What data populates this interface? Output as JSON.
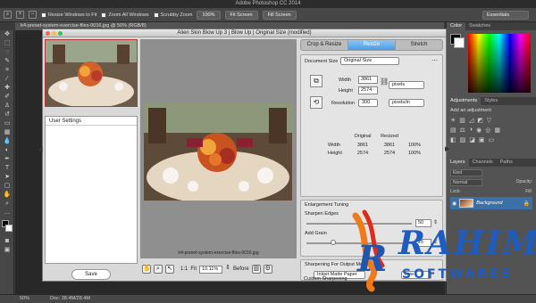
{
  "app": {
    "title": "Adobe Photoshop CC 2014",
    "document_tab": "lr4-preset-system-exercise-files-0016.jpg @ 50% (RGB/8)",
    "status_zoom": "50%",
    "status_doc": "Doc: 28.4M/28.4M"
  },
  "options_bar": {
    "resize_windows": "Resize Windows to Fit",
    "zoom_all": "Zoom All Windows",
    "scrubby_zoom": "Scrubby Zoom",
    "btn_100": "100%",
    "btn_fit": "Fit Screen",
    "btn_fill": "Fill Screen",
    "workspace": "Essentials"
  },
  "panels": {
    "top_tabs": [
      "Color",
      "Swatches"
    ],
    "mid_tabs": [
      "Adjustments",
      "Styles"
    ],
    "add_adjustment": "Add an adjustment",
    "bottom_tabs": [
      "Layers",
      "Channels",
      "Paths"
    ],
    "kind": "Kind",
    "mode": "Normal",
    "opacity": "Opacity:",
    "lock": "Lock:",
    "fill": "Fill:",
    "layer_name": "Background"
  },
  "plugin": {
    "title": "Alien Skin Blow Up 3 | Blow Up | Original Size (modified)",
    "user_settings": "User Settings",
    "save": "Save",
    "preview_caption": "lr4-preset-system-exercise-files-0016.jpg",
    "zoom_ratio": "1:1",
    "fit": "Fit",
    "zoom_value": "10.11%",
    "before": "Before",
    "tabs": [
      "Crop & Resize",
      "Resize",
      "Stretch"
    ],
    "document_size_label": "Document Size",
    "document_size_value": "Original Size",
    "width_label": "Width",
    "width_value": "3861",
    "height_label": "Height",
    "height_value": "2574",
    "units": "pixels",
    "resolution_label": "Resolution",
    "resolution_value": "300",
    "resolution_units": "pixels/in",
    "table": {
      "headers": [
        "Original",
        "Resized"
      ],
      "rows": [
        {
          "label": "Width",
          "original": "3861",
          "resized": "3861",
          "pct": "100%"
        },
        {
          "label": "Height",
          "original": "2574",
          "resized": "2574",
          "pct": "100%"
        }
      ]
    },
    "enlargement_title": "Enlargement Tuning",
    "sharpen_label": "Sharpen Edges",
    "sharpen_value": "50",
    "sharpen_level": 0.5,
    "grain_label": "Add Grain",
    "grain_value": "25",
    "grain_level": 0.25,
    "output_title": "Sharpening For Output Medium",
    "output_medium": "Inkjet Matte Paper",
    "output_amount": "Low",
    "custom_label": "Custom Sharpening"
  },
  "watermark": {
    "text": "RAHIM",
    "subtext": "SOFTWARES"
  }
}
